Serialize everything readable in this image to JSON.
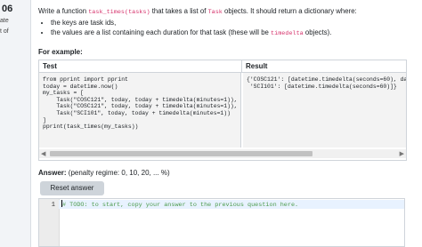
{
  "sidebar": {
    "question_number": "06",
    "side_text_1": "ate",
    "side_text_2": "t of"
  },
  "question": {
    "intro_before": "Write a function ",
    "function_name": "task_times(tasks)",
    "intro_mid": " that takes a list of ",
    "class_name": "Task",
    "intro_after": " objects. It should return a dictionary where:",
    "bullet_1": "the keys are task ids,",
    "bullet_2_before": "the values are a list containing each duration for that task (these will be ",
    "bullet_2_code": "timedelta",
    "bullet_2_after": " objects)."
  },
  "example": {
    "heading": "For example:",
    "col_test": "Test",
    "col_result": "Result",
    "test_code": "from pprint import pprint\ntoday = datetime.now()\nmy_tasks = [\n    Task(\"COSC121\", today, today + timedelta(minutes=1)),\n    Task(\"COSC121\", today, today + timedelta(minutes=1)),\n    Task(\"SCI101\", today, today + timedelta(minutes=1))\n]\npprint(task_times(my_tasks))",
    "result_code": "{'COSC121': [datetime.timedelta(seconds=60), da\n 'SCI101': [datetime.timedelta(seconds=60)]}"
  },
  "answer": {
    "label": "Answer:",
    "penalty": "(penalty regime: 0, 10, 20, ... %)",
    "reset_label": "Reset answer",
    "line_number": "1",
    "code_line": "# TODO: to start, copy your answer to the previous question here."
  },
  "icons": {
    "scroll_left": "scroll-left-arrow",
    "scroll_right": "scroll-right-arrow"
  }
}
